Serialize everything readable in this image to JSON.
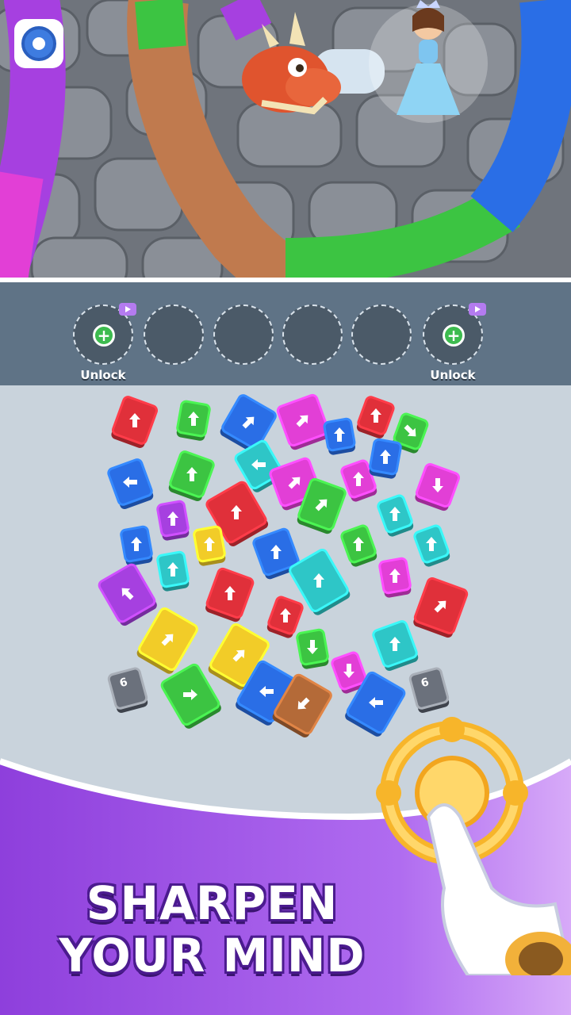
{
  "settings": {
    "icon": "gear-icon"
  },
  "slots": [
    {
      "state": "locked",
      "label": "Unlock",
      "icon": "plus-icon",
      "badge": "video-icon"
    },
    {
      "state": "empty",
      "label": ""
    },
    {
      "state": "empty",
      "label": ""
    },
    {
      "state": "empty",
      "label": ""
    },
    {
      "state": "empty",
      "label": ""
    },
    {
      "state": "locked",
      "label": "Unlock",
      "icon": "plus-icon",
      "badge": "video-icon"
    }
  ],
  "blocks": [
    {
      "color": "#e0303a",
      "dir": "up"
    },
    {
      "color": "#3cc442",
      "dir": "up"
    },
    {
      "color": "#2a6ee6",
      "dir": "up-right"
    },
    {
      "color": "#e23fd6",
      "dir": "up-right"
    },
    {
      "color": "#e0303a",
      "dir": "up"
    },
    {
      "color": "#2a6ee6",
      "dir": "up"
    },
    {
      "color": "#3cc442",
      "dir": "down-right"
    },
    {
      "color": "#2a6ee6",
      "dir": "left"
    },
    {
      "color": "#3cc442",
      "dir": "up"
    },
    {
      "color": "#2ec6c7",
      "dir": "left"
    },
    {
      "color": "#e23fd6",
      "dir": "up-right"
    },
    {
      "color": "#e23fd6",
      "dir": "up"
    },
    {
      "color": "#2a6ee6",
      "dir": "up"
    },
    {
      "color": "#e23fd6",
      "dir": "down"
    },
    {
      "color": "#a640e0",
      "dir": "up"
    },
    {
      "color": "#e0303a",
      "dir": "up"
    },
    {
      "color": "#3cc442",
      "dir": "up-right"
    },
    {
      "color": "#2ec6c7",
      "dir": "up"
    },
    {
      "color": "#2a6ee6",
      "dir": "up"
    },
    {
      "color": "#f2cc28",
      "dir": "up"
    },
    {
      "color": "#2ec6c7",
      "dir": "up"
    },
    {
      "color": "#2a6ee6",
      "dir": "up"
    },
    {
      "color": "#3cc442",
      "dir": "up"
    },
    {
      "color": "#2ec6c7",
      "dir": "up"
    },
    {
      "color": "#a640e0",
      "dir": "up-left"
    },
    {
      "color": "#e0303a",
      "dir": "up"
    },
    {
      "color": "#2ec6c7",
      "dir": "up"
    },
    {
      "color": "#e23fd6",
      "dir": "up"
    },
    {
      "color": "#e0303a",
      "dir": "up-right"
    },
    {
      "color": "#e0303a",
      "dir": "up"
    },
    {
      "color": "#f2cc28",
      "dir": "up-right"
    },
    {
      "color": "#f2cc28",
      "dir": "up-right"
    },
    {
      "color": "#3cc442",
      "dir": "down"
    },
    {
      "color": "#2ec6c7",
      "dir": "up"
    },
    {
      "color": "#e23fd6",
      "dir": "down"
    },
    {
      "color": "#3cc442",
      "dir": "right"
    },
    {
      "color": "#2a6ee6",
      "dir": "left"
    },
    {
      "color": "#b46a38",
      "dir": "down-left"
    },
    {
      "color": "#2a6ee6",
      "dir": "left"
    }
  ],
  "locks": [
    {
      "count": "6"
    },
    {
      "count": "6"
    }
  ],
  "headline": {
    "line1": "SHARPEN",
    "line2": "YOUR MIND"
  },
  "colors": {
    "slot_bar": "#5f7386",
    "board": "#c9d3dc",
    "promo": "#a55ae8",
    "headline_outline": "#4b1b8f"
  }
}
